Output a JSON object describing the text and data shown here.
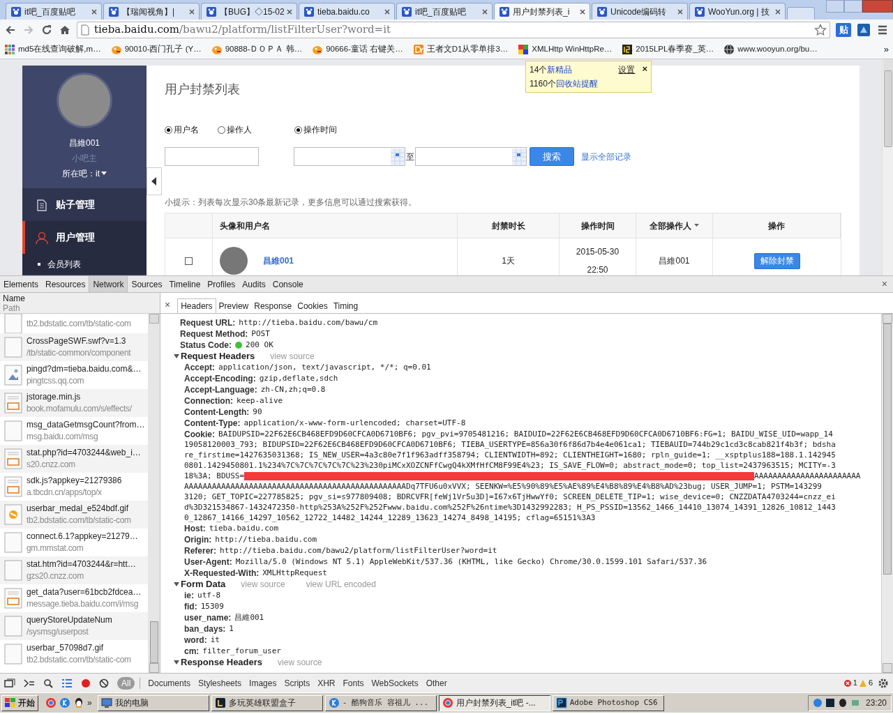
{
  "browser": {
    "tabs": [
      {
        "label": "it吧_百度贴吧",
        "selected": false
      },
      {
        "label": "【瑞闻视角】|",
        "selected": false
      },
      {
        "label": "【BUG】◇15-02",
        "selected": false
      },
      {
        "label": "tieba.baidu.co",
        "selected": false
      },
      {
        "label": "it吧_百度贴吧",
        "selected": false
      },
      {
        "label": "用户封禁列表_i",
        "selected": true
      },
      {
        "label": "Unicode编码转",
        "selected": false
      },
      {
        "label": "WooYun.org | 技",
        "selected": false
      }
    ],
    "address": {
      "host": "tieba.baidu.com",
      "path": "/bawu2/platform/listFilterUser?word=it"
    },
    "extension_label": "贴",
    "bookmarks": [
      {
        "label": "md5在线查询破解,m…",
        "kind": "grid"
      },
      {
        "label": "90010-西门孔子 (Y…",
        "kind": "duck"
      },
      {
        "label": "90888-ＤＯＰＡ 韩…",
        "kind": "duck"
      },
      {
        "label": "90666-童话 右键关…",
        "kind": "duck"
      },
      {
        "label": "王者文D1从零单排3…",
        "kind": "dy"
      },
      {
        "label": "XMLHttp WinHttpRe…",
        "kind": "color"
      },
      {
        "label": "2015LPL春季赛_英…",
        "kind": "box"
      },
      {
        "label": "www.wooyun.org/bu…",
        "kind": "globe"
      }
    ],
    "bookmarks_more": "»"
  },
  "page": {
    "sidebar": {
      "username": "昌維001",
      "role": "小吧主",
      "forum": "所在吧：it",
      "menu": [
        {
          "label": "贴子管理",
          "selected": false,
          "kind": "posts"
        },
        {
          "label": "用户管理",
          "selected": true,
          "kind": "user"
        }
      ],
      "subitems": [
        "会员列表"
      ]
    },
    "title": "用户封禁列表",
    "radios": [
      {
        "label": "用户名",
        "selected": true
      },
      {
        "label": "操作人",
        "selected": false
      },
      {
        "label": "操作时间",
        "selected": true
      }
    ],
    "to_label": "至",
    "search_button": "搜索",
    "show_all": "显示全部记录",
    "hint": "小提示：列表每次显示30条最新记录，更多信息可以通过搜索获得。",
    "table": {
      "columns": [
        "头像和用户名",
        "封禁时长",
        "操作时间",
        "全部操作人",
        "操作"
      ],
      "rows": [
        {
          "checked": false,
          "username": "昌維001",
          "duration": "1天",
          "date": "2015-05-30",
          "time": "22:50",
          "operator": "昌維001",
          "action": "解除封禁"
        }
      ]
    },
    "popup": {
      "lines": [
        {
          "count": "14个",
          "link": "新精品"
        },
        {
          "count": "1160个",
          "link": "回收站提醒"
        }
      ],
      "settings": "设置",
      "close": "×"
    }
  },
  "devtools": {
    "tabs": [
      {
        "label": "Elements",
        "selected": false
      },
      {
        "label": "Resources",
        "selected": false
      },
      {
        "label": "Network",
        "selected": true
      },
      {
        "label": "Sources",
        "selected": false
      },
      {
        "label": "Timeline",
        "selected": false
      },
      {
        "label": "Profiles",
        "selected": false
      },
      {
        "label": "Audits",
        "selected": false
      },
      {
        "label": "Console",
        "selected": false
      }
    ],
    "close": "×",
    "list_header": {
      "name": "Name",
      "path": "Path"
    },
    "requests": [
      {
        "path": "tb2.bdstatic.com/tb/static-com",
        "kind": "blank"
      },
      {
        "name": "CrossPageSWF.swf?v=1.3",
        "path": "/tb/static-common/component",
        "kind": "blank"
      },
      {
        "name": "pingd?dm=tieba.baidu.com&…",
        "path": "pingtcss.qq.com",
        "kind": "image"
      },
      {
        "name": "jstorage.min.js",
        "path": "book.mofamulu.com/s/effects/",
        "kind": "js"
      },
      {
        "name": "msg_dataGetmsgCount?from…",
        "path": "msg.baidu.com/msg",
        "kind": "blank"
      },
      {
        "name": "stat.php?id=4703244&web_i…",
        "path": "s20.cnzz.com",
        "kind": "js"
      },
      {
        "name": "sdk.js?appkey=21279386",
        "path": "a.tbcdn.cn/apps/top/x",
        "kind": "js"
      },
      {
        "name": "userbar_medal_e524bdf.gif",
        "path": "tb2.bdstatic.com/tb/static-com",
        "kind": "gif"
      },
      {
        "name": "connect.6.1?appkey=21279…",
        "path": "gm.mmstat.com",
        "kind": "blank"
      },
      {
        "name": "stat.htm?id=4703244&r=htt…",
        "path": "gzs20.cnzz.com",
        "kind": "blank"
      },
      {
        "name": "get_data?user=61bcb2fdcea…",
        "path": "message.tieba.baidu.com/i/msg",
        "kind": "js"
      },
      {
        "name": "queryStoreUpdateNum",
        "path": "/sysmsg/userpost",
        "kind": "blank"
      },
      {
        "name": "userbar_57098d7.gif",
        "path": "tb2.bdstatic.com/tb/static-com",
        "kind": "blank"
      }
    ],
    "detail_close": "×",
    "detail_tabs": [
      {
        "label": "Headers",
        "selected": true
      },
      {
        "label": "Preview",
        "selected": false
      },
      {
        "label": "Response",
        "selected": false
      },
      {
        "label": "Cookies",
        "selected": false
      },
      {
        "label": "Timing",
        "selected": false
      }
    ],
    "general": [
      {
        "key": "Request URL:",
        "value": "http://tieba.baidu.com/bawu/cm",
        "kind": "text"
      },
      {
        "key": "Request Method:",
        "value": "POST",
        "kind": "text"
      },
      {
        "key": "Status Code:",
        "value": "200 OK",
        "kind": "status"
      }
    ],
    "sections": [
      {
        "title": "Request Headers",
        "links": [
          "view source"
        ],
        "expanded": true,
        "entries": [
          {
            "key": "Accept:",
            "value": "application/json, text/javascript, */*; q=0.01"
          },
          {
            "key": "Accept-Encoding:",
            "value": "gzip,deflate,sdch"
          },
          {
            "key": "Accept-Language:",
            "value": "zh-CN,zh;q=0.8"
          },
          {
            "key": "Connection:",
            "value": "keep-alive"
          },
          {
            "key": "Content-Length:",
            "value": "90"
          },
          {
            "key": "Content-Type:",
            "value": "application/x-www-form-urlencoded; charset=UTF-8"
          },
          {
            "key": "Cookie:",
            "lines": [
              [
                {
                  "kind": "text",
                  "text": "BAIDUPSID=22F62E6CB468EFD9D60CFCA0D6710BF6; pgv_pvi=9705481216; BAIDUID=22F62E6CB468EFD9D60CFCA0D6710BF6:FG=1; BAIDU_WISE_UID=wapp_14"
                }
              ],
              [
                {
                  "kind": "text",
                  "text": "19058120003_793; BIDUPSID=22F62E6CB468EFD9D60CFCA0D6710BF6; TIEBA_USERTYPE=856a30f6f86d7b4e4e061ca1; TIEBAUID=744b29c1cd3c8cab821f4b3f; bdsha"
                }
              ],
              [
                {
                  "kind": "text",
                  "text": "re_firstime=1427635031368; IS_NEW_USER=4a3c80e7f1f963adff358794; CLIENTWIDTH=892; CLIENTHEIGHT=1680; rpln_guide=1; __xsptplus188=188.1.142945"
                }
              ],
              [
                {
                  "kind": "text",
                  "text": "0801.1429450801.1%234%7C%7C%7C%7C%7C%23%230piMCxXOZCNFfCwgQ4kXMfHfCM8F99E4%23; IS_SAVE_FLOW=0; abstract_mode=0; top_list=2437963515; MCITY=-3"
                }
              ],
              [
                {
                  "kind": "text",
                  "text": "18%3A; BDUSS="
                },
                {
                  "kind": "redacted"
                },
                {
                  "kind": "text",
                  "text": "AAAAAAAAAAAAAAAAAAAAAAA"
                }
              ],
              [
                {
                  "kind": "text",
                  "text": "AAAAAAAAAAAAAAAAAAAAAAAAAAAAAAAAAAAAAAAAAAAAAAAADq7TFU6u0xVVX; SEENKW=%E5%90%89%E5%AE%89%E4%B8%89%E4%B8%AD%23bug; USER_JUMP=1; PSTM=143299"
                }
              ],
              [
                {
                  "kind": "text",
                  "text": "3120; GET_TOPIC=227785825; pgv_si=s977809408; BDRCVFR[feWj1Vr5u3D]=I67x6TjHwwYf0; SCREEN_DELETE_TIP=1; wise_device=0; CNZZDATA4703244=cnzz_ei"
                }
              ],
              [
                {
                  "kind": "text",
                  "text": "d%3D321534867-1432472350-http%253A%252F%252Fwww.baidu.com%252F%26ntime%3D1432992283; H_PS_PSSID=13562_1466_14410_13074_14391_12826_10812_1443"
                }
              ],
              [
                {
                  "kind": "text",
                  "text": "0_12867_14166_14297_10562_12722_14482_14244_12289_13623_14274_8498_14195; cflag=65151%3A3"
                }
              ]
            ]
          },
          {
            "key": "Host:",
            "value": "tieba.baidu.com"
          },
          {
            "key": "Origin:",
            "value": "http://tieba.baidu.com"
          },
          {
            "key": "Referer:",
            "value": "http://tieba.baidu.com/bawu2/platform/listFilterUser?word=it"
          },
          {
            "key": "User-Agent:",
            "value": "Mozilla/5.0 (Windows NT 5.1) AppleWebKit/537.36 (KHTML, like Gecko) Chrome/30.0.1599.101 Safari/537.36"
          },
          {
            "key": "X-Requested-With:",
            "value": "XMLHttpRequest"
          }
        ]
      },
      {
        "title": "Form Data",
        "links": [
          "view source",
          "view URL encoded"
        ],
        "expanded": true,
        "entries": [
          {
            "key": "ie:",
            "value": "utf-8"
          },
          {
            "key": "fid:",
            "value": "15309"
          },
          {
            "key": "user_name:",
            "value": "昌維001"
          },
          {
            "key": "ban_days:",
            "value": "1"
          },
          {
            "key": "word:",
            "value": "it"
          },
          {
            "key": "cm:",
            "value": "filter_forum_user"
          }
        ]
      },
      {
        "title": "Response Headers",
        "links": [
          "view source"
        ],
        "expanded": true
      }
    ],
    "filters": [
      {
        "label": "All",
        "selected": true
      },
      {
        "label": "Documents",
        "selected": false
      },
      {
        "label": "Stylesheets",
        "selected": false
      },
      {
        "label": "Images",
        "selected": false
      },
      {
        "label": "Scripts",
        "selected": false
      },
      {
        "label": "XHR",
        "selected": false
      },
      {
        "label": "Fonts",
        "selected": false
      },
      {
        "label": "WebSockets",
        "selected": false
      },
      {
        "label": "Other",
        "selected": false
      }
    ],
    "errors": "1",
    "warnings": "6"
  },
  "taskbar": {
    "start": "开始",
    "more": "»",
    "tasks": [
      {
        "label": "我的电脑",
        "selected": false,
        "kind": "computer"
      },
      {
        "label": "多玩英雄联盟盒子",
        "selected": false,
        "kind": "game"
      },
      {
        "label": "- 酷狗音乐 容祖儿 ...",
        "selected": false,
        "kind": "music"
      },
      {
        "label": "用户封禁列表_it吧 -...",
        "selected": true,
        "kind": "browser"
      },
      {
        "label": "Adobe Photoshop CS6",
        "selected": false,
        "kind": "ps"
      }
    ],
    "clock": "23:20"
  }
}
